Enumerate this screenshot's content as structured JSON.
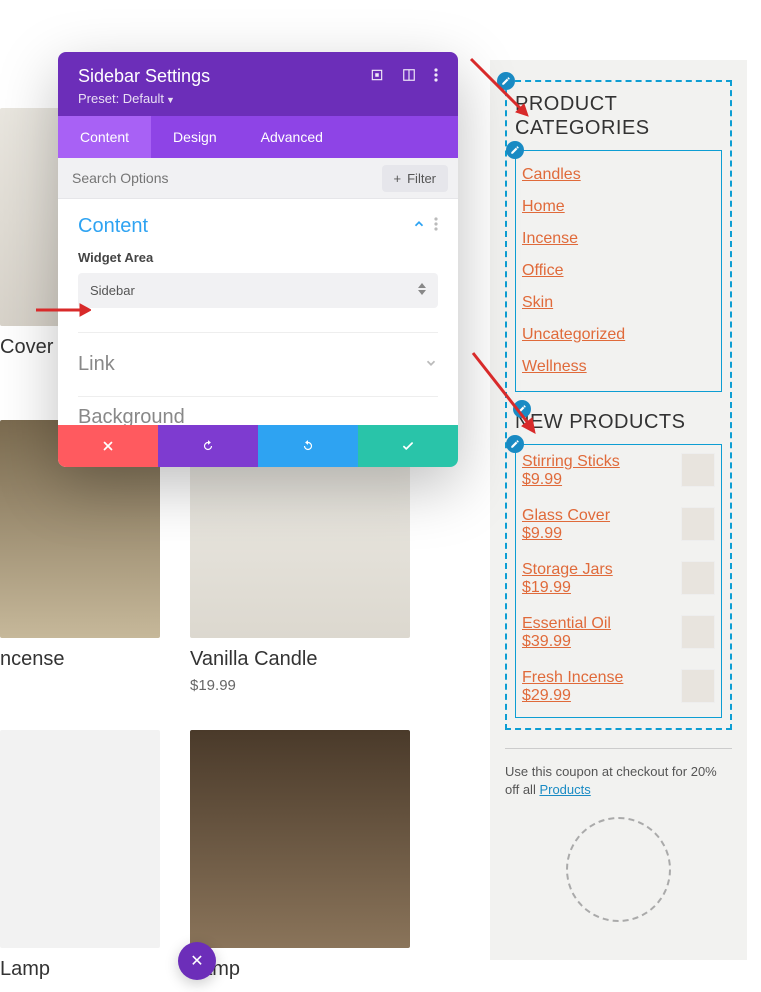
{
  "panel": {
    "title": "Sidebar Settings",
    "preset_label": "Preset: Default",
    "tabs": {
      "content": "Content",
      "design": "Design",
      "advanced": "Advanced"
    },
    "search_placeholder": "Search Options",
    "filter_label": "Filter",
    "group_content": "Content",
    "widget_area_label": "Widget Area",
    "widget_area_value": "Sidebar",
    "group_link": "Link",
    "group_bg": "Background"
  },
  "products": {
    "p1": {
      "title": "Cover",
      "price": ""
    },
    "p2": {
      "title": "ncense",
      "price": ""
    },
    "p3": {
      "title": "Vanilla Candle",
      "price": "$19.99"
    },
    "p4": {
      "title": "Lamp",
      "price": ""
    },
    "p5": {
      "title": "Lamp",
      "price": ""
    }
  },
  "sidebar": {
    "categories_title": "PRODUCT CATEGORIES",
    "categories": [
      "Candles",
      "Home",
      "Incense",
      "Office",
      "Skin",
      "Uncategorized",
      "Wellness"
    ],
    "new_products_title": "NEW PRODUCTS",
    "new_products": [
      {
        "name": "Stirring Sticks",
        "price": "$9.99"
      },
      {
        "name": "Glass Cover",
        "price": "$9.99"
      },
      {
        "name": "Storage Jars",
        "price": "$19.99"
      },
      {
        "name": "Essential Oil",
        "price": "$39.99"
      },
      {
        "name": "Fresh Incense",
        "price": "$29.99"
      }
    ],
    "coupon_text": "Use this coupon at checkout for 20% off all ",
    "coupon_link": "Products"
  }
}
